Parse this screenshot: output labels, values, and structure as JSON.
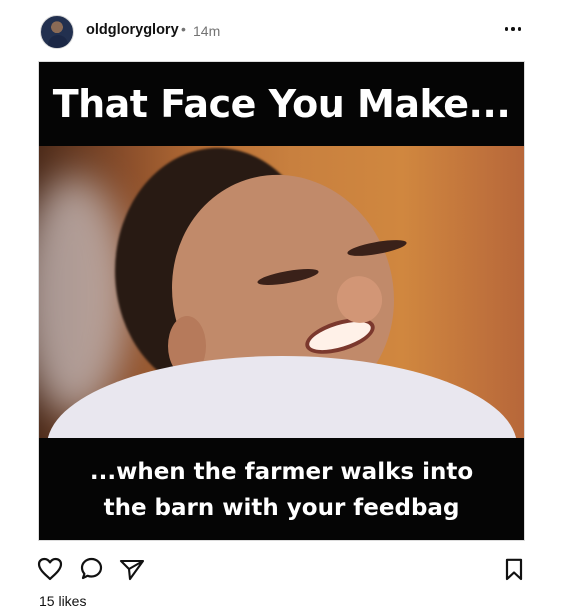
{
  "post": {
    "username": "oldgloryglory",
    "separator": "•",
    "time": "14m",
    "meme": {
      "top_text": "That Face You Make...",
      "bottom_line_1": "...when the farmer walks into",
      "bottom_line_2": "the barn with your feedbag"
    },
    "likes": "15 likes"
  },
  "icons": {
    "more": "more-options-icon",
    "like": "heart-icon",
    "comment": "comment-bubble-icon",
    "share": "send-paper-plane-icon",
    "save": "bookmark-icon"
  },
  "colors": {
    "text": "#111111",
    "muted": "#737373",
    "meme_background": "#050505"
  }
}
